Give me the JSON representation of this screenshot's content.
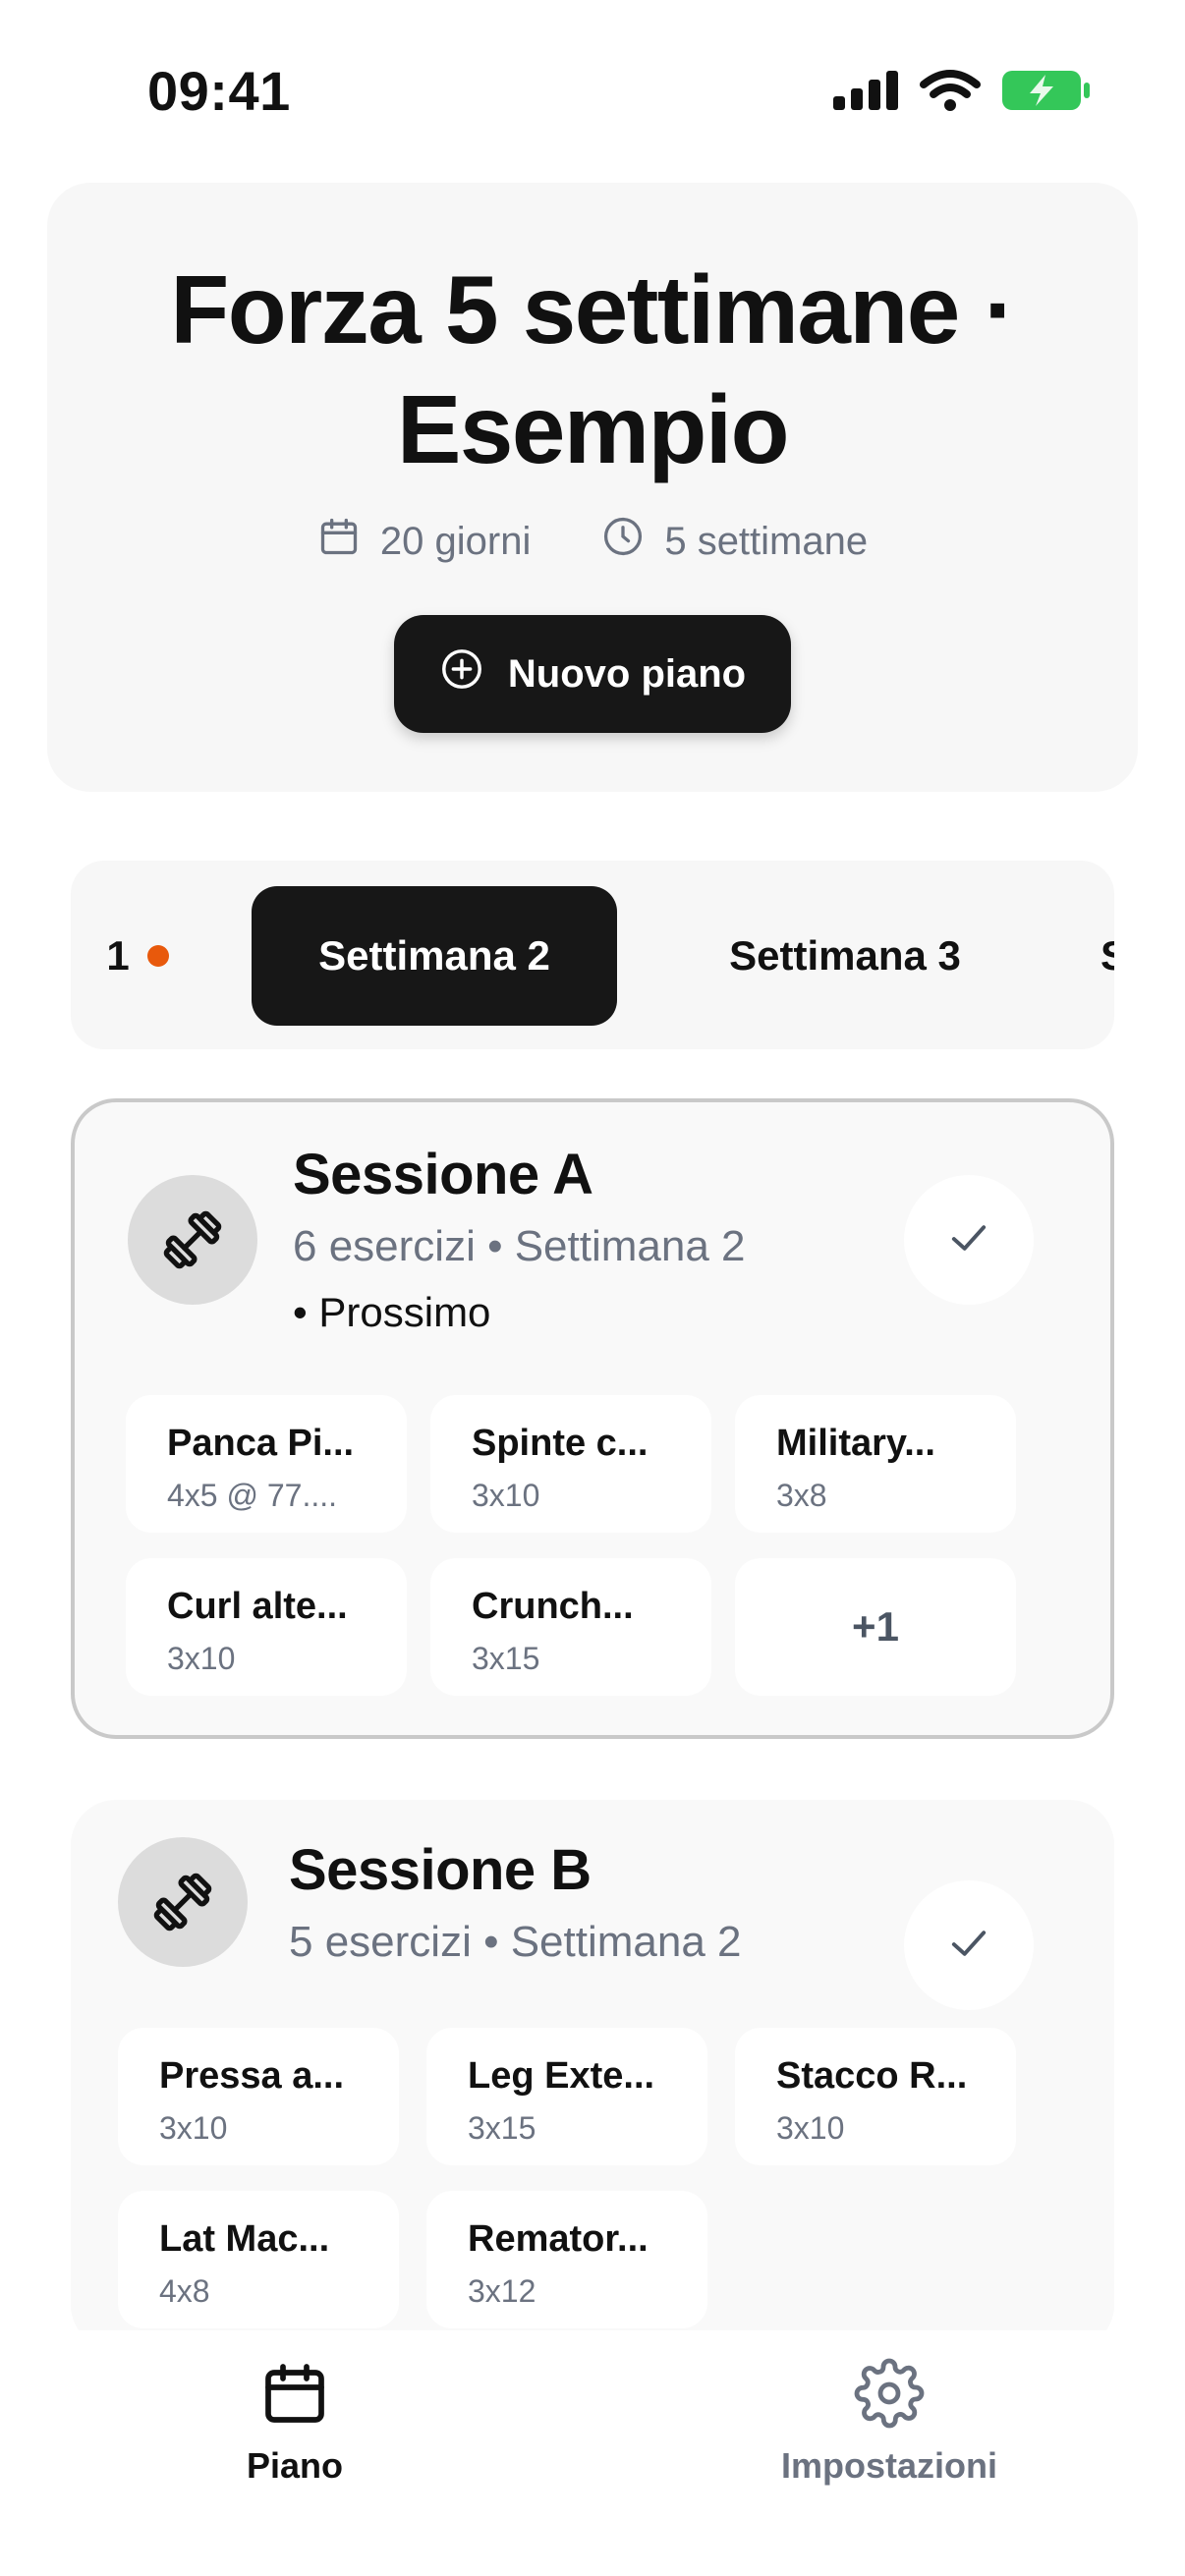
{
  "status_bar": {
    "time": "09:41",
    "icons": [
      "signal-icon",
      "wifi-icon",
      "battery-charging-icon"
    ],
    "battery_color": "#34c759"
  },
  "header": {
    "title_line1": "Forza 5 settimane ·",
    "title_line2": "Esempio",
    "days": "20 giorni",
    "weeks": "5 settimane",
    "new_plan_label": "Nuovo piano"
  },
  "weeks": {
    "tabs": [
      {
        "label": "1",
        "current": true
      },
      {
        "label": "Settimana 2",
        "selected": true
      },
      {
        "label": "Settimana 3"
      },
      {
        "label": "S"
      }
    ],
    "current_dot_color": "#e8590c"
  },
  "sessions": [
    {
      "title": "Sessione A",
      "subtitle": "6 esercizi • Settimana 2",
      "next_label": "• Prossimo",
      "exercises": [
        {
          "name": "Panca Pi...",
          "detail": "4x5 @ 77...."
        },
        {
          "name": "Spinte c...",
          "detail": "3x10"
        },
        {
          "name": "Military...",
          "detail": "3x8"
        },
        {
          "name": "Curl alte...",
          "detail": "3x10"
        },
        {
          "name": "Crunch...",
          "detail": "3x15"
        }
      ],
      "more": "+1"
    },
    {
      "title": "Sessione B",
      "subtitle": "5 esercizi • Settimana 2",
      "exercises": [
        {
          "name": "Pressa a...",
          "detail": "3x10"
        },
        {
          "name": "Leg Exte...",
          "detail": "3x15"
        },
        {
          "name": "Stacco R...",
          "detail": "3x10"
        },
        {
          "name": "Lat Mac...",
          "detail": "4x8"
        },
        {
          "name": "Remator...",
          "detail": "3x12"
        }
      ]
    }
  ],
  "nav": {
    "items": [
      {
        "label": "Piano",
        "icon": "calendar-icon",
        "active": true
      },
      {
        "label": "Impostazioni",
        "icon": "gear-icon",
        "active": false
      }
    ]
  },
  "colors": {
    "primary": "#171717",
    "muted_text": "#6b7280",
    "card_bg": "#f7f7f7",
    "accent_dot": "#e8590c"
  }
}
